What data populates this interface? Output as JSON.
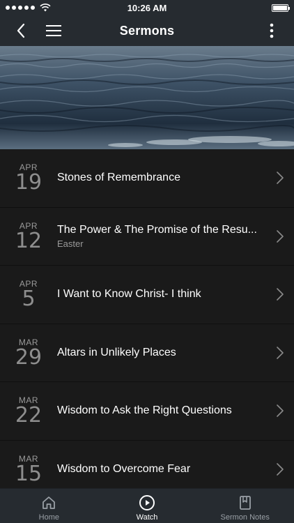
{
  "status": {
    "time": "10:26 AM"
  },
  "nav": {
    "title": "Sermons"
  },
  "sermons": [
    {
      "month": "APR",
      "day": "19",
      "title": "Stones of Remembrance",
      "subtitle": ""
    },
    {
      "month": "APR",
      "day": "12",
      "title": "The Power & The Promise of the Resu...",
      "subtitle": "Easter"
    },
    {
      "month": "APR",
      "day": "5",
      "title": "I Want to Know Christ- I think",
      "subtitle": ""
    },
    {
      "month": "MAR",
      "day": "29",
      "title": "Altars in Unlikely Places",
      "subtitle": ""
    },
    {
      "month": "MAR",
      "day": "22",
      "title": "Wisdom to Ask the Right Questions",
      "subtitle": ""
    },
    {
      "month": "MAR",
      "day": "15",
      "title": "Wisdom to Overcome Fear",
      "subtitle": ""
    }
  ],
  "tabs": [
    {
      "label": "Home",
      "icon": "home-icon",
      "active": false
    },
    {
      "label": "Watch",
      "icon": "play-circle-icon",
      "active": true
    },
    {
      "label": "Sermon Notes",
      "icon": "notebook-icon",
      "active": false
    }
  ],
  "colors": {
    "background": "#1a1a1a",
    "bar": "#262b30",
    "text": "#ffffff",
    "muted": "#9a9a9a"
  }
}
